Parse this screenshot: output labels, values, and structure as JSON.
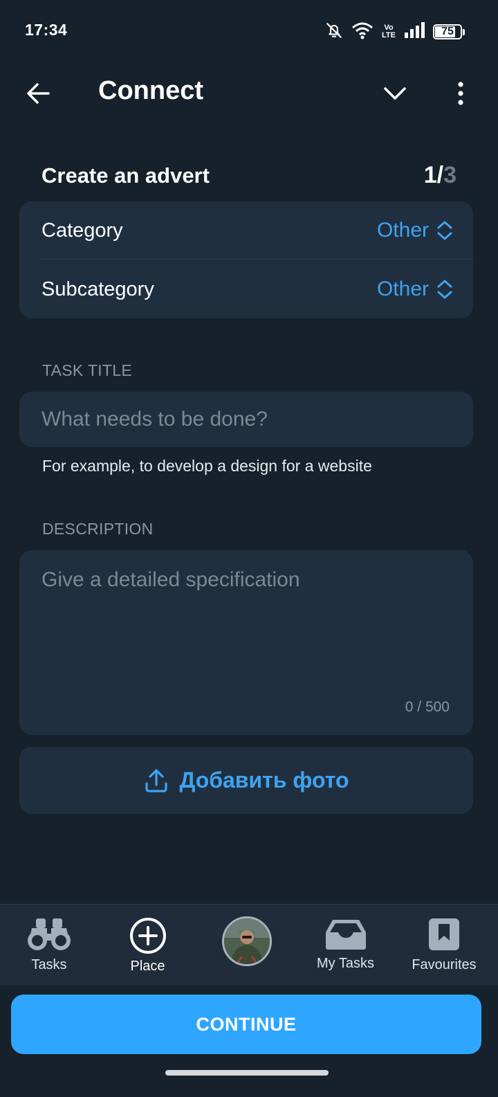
{
  "status_bar": {
    "time": "17:34",
    "icons": [
      "bell-off-icon",
      "wifi-icon",
      "volte-icon",
      "signal-icon",
      "battery-icon"
    ],
    "volte_top": "Vo",
    "volte_bottom": "LTE",
    "battery_level": "75"
  },
  "header": {
    "title": "Connect",
    "back_icon": "arrow-left-icon",
    "chevron_icon": "chevron-down-icon",
    "more_icon": "more-vertical-icon"
  },
  "form": {
    "title": "Create an advert",
    "step_current": "1",
    "step_separator": "/",
    "step_total": "3",
    "category": {
      "label": "Category",
      "value": "Other"
    },
    "subcategory": {
      "label": "Subcategory",
      "value": "Other"
    },
    "task_title": {
      "label": "TASK TITLE",
      "placeholder": "What needs to be done?",
      "value": "",
      "hint": "For example, to develop a design for a website"
    },
    "description": {
      "label": "DESCRIPTION",
      "placeholder": "Give a detailed specification",
      "value": "",
      "counter": "0 / 500"
    },
    "add_photo_label": "Добавить фото"
  },
  "bottom_nav": {
    "items": [
      {
        "label": "Tasks",
        "icon": "binoculars-icon"
      },
      {
        "label": "Place",
        "icon": "plus-circle-icon"
      },
      {
        "label": "",
        "icon": "profile-avatar"
      },
      {
        "label": "My Tasks",
        "icon": "inbox-icon"
      },
      {
        "label": "Favourites",
        "icon": "bookmark-icon"
      }
    ]
  },
  "continue_label": "CONTINUE",
  "colors": {
    "background": "#17212b",
    "card": "#202f40",
    "accent": "#2ea6ff",
    "link": "#3fa3f0",
    "muted": "#8a96a3"
  }
}
